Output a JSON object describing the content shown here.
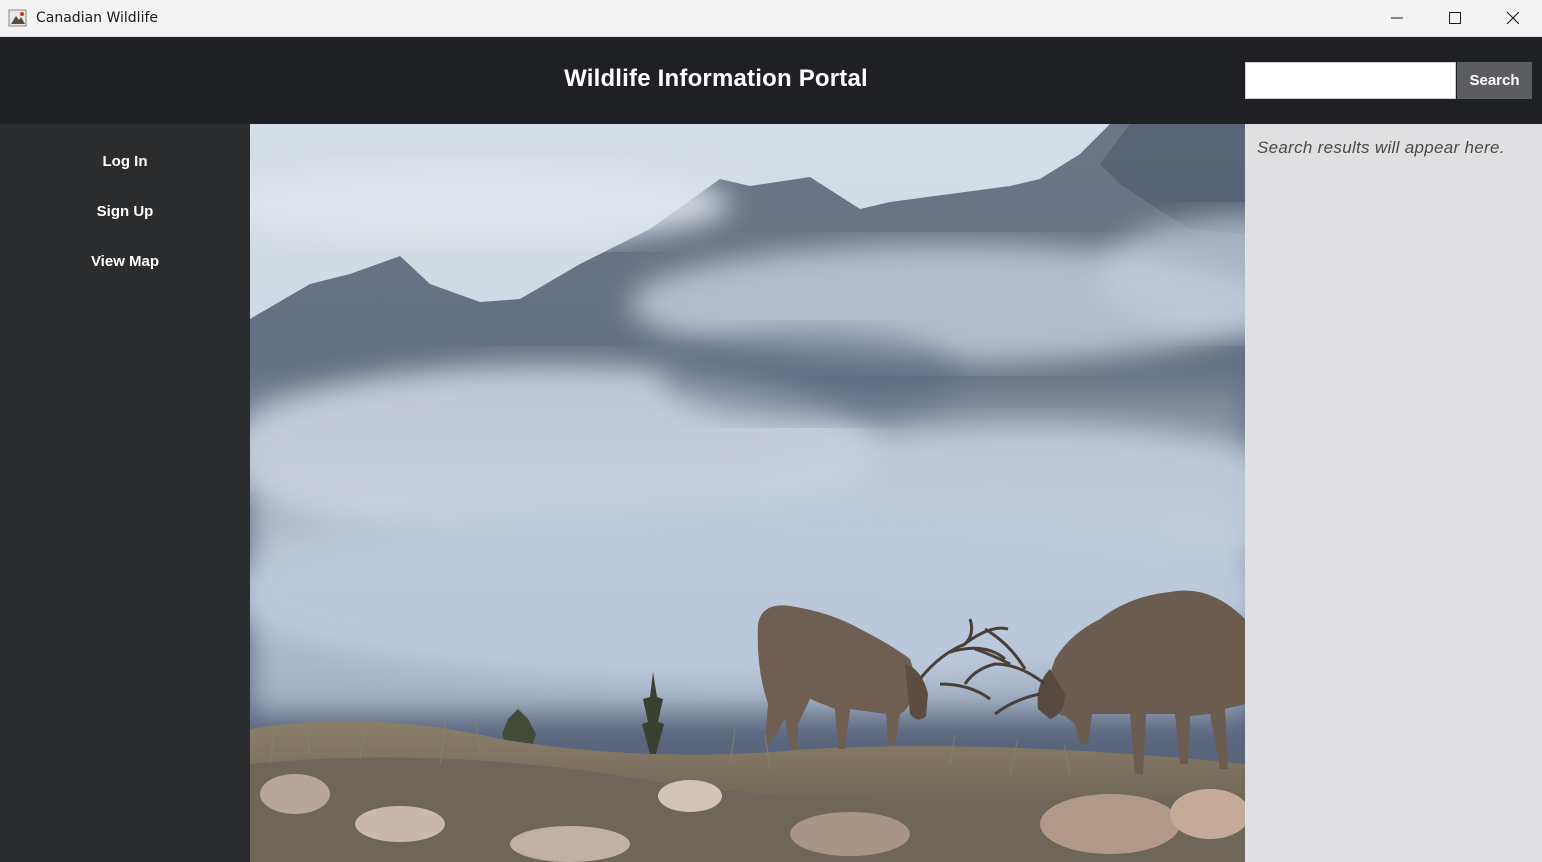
{
  "window": {
    "title": "Canadian Wildlife",
    "icons": [
      "app-icon",
      "minimize-icon",
      "maximize-icon",
      "close-icon"
    ]
  },
  "header": {
    "title": "Wildlife Information Portal",
    "search": {
      "value": "",
      "placeholder": "",
      "button_label": "Search"
    },
    "background_color": "#1f2023"
  },
  "sidebar": {
    "items": [
      {
        "label": "Log In"
      },
      {
        "label": "Sign Up"
      },
      {
        "label": "View Map"
      }
    ],
    "background_color": "#2b2c2e"
  },
  "main": {
    "image_subject": "two elk sparring in front of misty mountains"
  },
  "results_panel": {
    "text": "Search results will appear here.",
    "background_color": "#e0e0e3"
  }
}
